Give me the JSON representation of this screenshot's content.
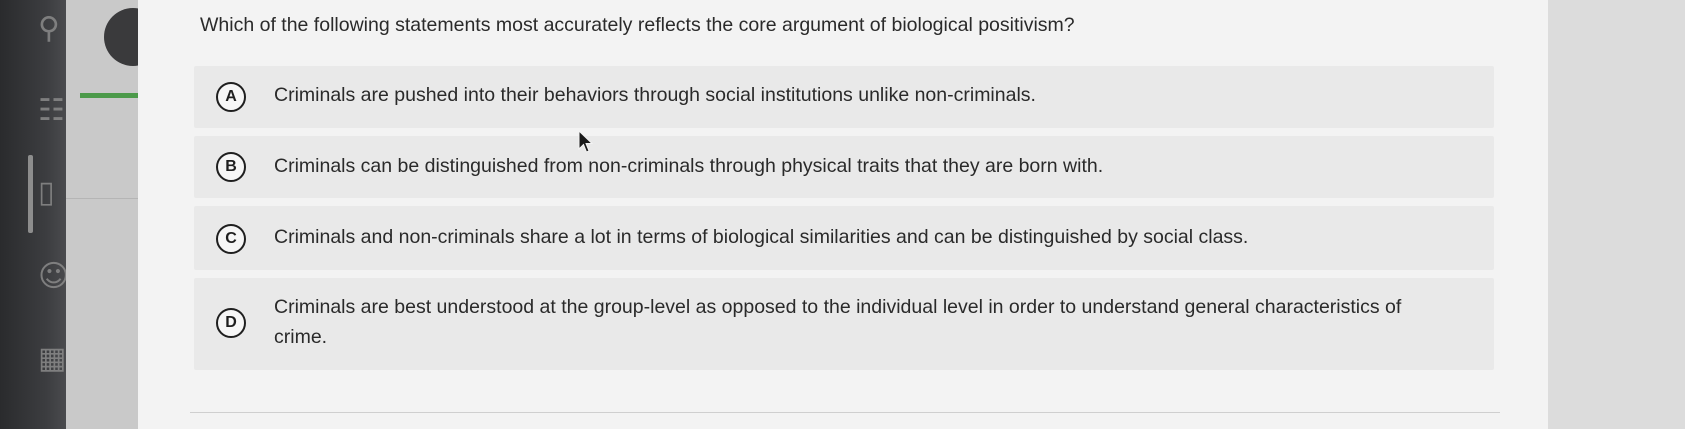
{
  "question": {
    "text": "Which of the following statements most accurately reflects the core argument of biological positivism?"
  },
  "options": [
    {
      "letter": "A",
      "text": "Criminals are pushed into their behaviors through social institutions unlike non-criminals."
    },
    {
      "letter": "B",
      "text": "Criminals can be distinguished from non-criminals through physical traits that they are born with."
    },
    {
      "letter": "C",
      "text": "Criminals and non-criminals share a lot in terms of biological similarities and can be distinguished by social class."
    },
    {
      "letter": "D",
      "text": "Criminals are best understood at the group-level as opposed to the individual level in order to understand general characteristics of crime."
    }
  ],
  "sidebar": {
    "icons": [
      "search-icon",
      "globe-icon",
      "book-icon",
      "users-icon",
      "calendar-icon"
    ]
  },
  "colors": {
    "accent": "#4c9a4a",
    "option_bg": "#e9e9e9",
    "page_bg": "#f3f3f3",
    "rail_bg": "#333436"
  }
}
